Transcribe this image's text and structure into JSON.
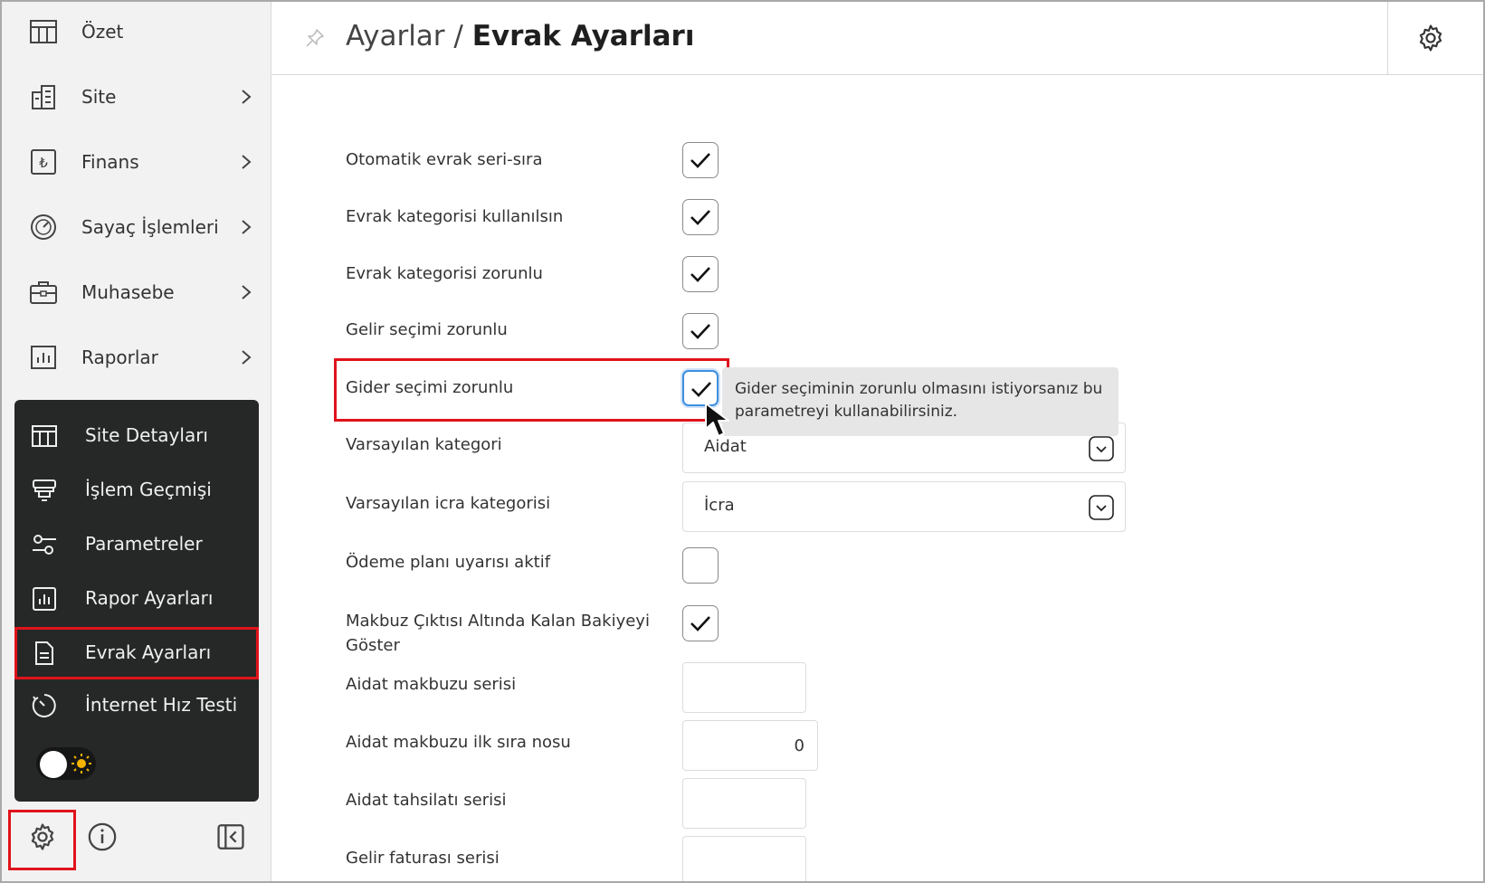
{
  "sidebar": {
    "items": [
      {
        "label": "Özet",
        "icon": "table-icon",
        "has_chevron": false
      },
      {
        "label": "Site",
        "icon": "building-icon",
        "has_chevron": true
      },
      {
        "label": "Finans",
        "icon": "lira-icon",
        "has_chevron": true
      },
      {
        "label": "Sayaç İşlemleri",
        "icon": "gauge-icon",
        "has_chevron": true
      },
      {
        "label": "Muhasebe",
        "icon": "briefcase-icon",
        "has_chevron": true
      },
      {
        "label": "Raporlar",
        "icon": "bar-chart-icon",
        "has_chevron": true
      }
    ],
    "submenu": [
      {
        "label": "Site Detayları",
        "icon": "table-icon"
      },
      {
        "label": "İşlem Geçmişi",
        "icon": "stack-icon"
      },
      {
        "label": "Parametreler",
        "icon": "sliders-icon"
      },
      {
        "label": "Rapor Ayarları",
        "icon": "bar-chart-icon"
      },
      {
        "label": "Evrak Ayarları",
        "icon": "document-icon",
        "active": true
      },
      {
        "label": "İnternet Hız Testi",
        "icon": "speed-icon"
      }
    ],
    "theme_toggle": {
      "state": "light",
      "icon": "sun-icon"
    },
    "bottom": {
      "settings_icon": "gear-icon",
      "info_icon": "info-icon",
      "collapse_icon": "collapse-sidebar-icon"
    }
  },
  "header": {
    "breadcrumb_parent": "Ayarlar",
    "separator": " / ",
    "breadcrumb_current": "Evrak Ayarları",
    "pin_icon": "pin-icon",
    "settings_icon": "gear-icon"
  },
  "form": {
    "rows": [
      {
        "label": "Otomatik evrak seri-sıra",
        "type": "checkbox",
        "checked": true
      },
      {
        "label": "Evrak kategorisi kullanılsın",
        "type": "checkbox",
        "checked": true
      },
      {
        "label": "Evrak kategorisi zorunlu",
        "type": "checkbox",
        "checked": true
      },
      {
        "label": "Gelir seçimi zorunlu",
        "type": "checkbox",
        "checked": true
      },
      {
        "label": "Gider seçimi zorunlu",
        "type": "checkbox",
        "checked": true,
        "focused": true
      },
      {
        "label": "Varsayılan kategori",
        "type": "select",
        "value": "Aidat"
      },
      {
        "label": "Varsayılan icra kategorisi",
        "type": "select",
        "value": "İcra"
      },
      {
        "label": "Ödeme planı uyarısı aktif",
        "type": "checkbox",
        "checked": false
      },
      {
        "label_line1": "Makbuz Çıktısı Altında Kalan Bakiyeyi",
        "label_line2": "Göster",
        "type": "checkbox",
        "checked": true
      },
      {
        "label": "Aidat makbuzu serisi",
        "type": "text",
        "value": ""
      },
      {
        "label": "Aidat makbuzu ilk sıra nosu",
        "type": "number",
        "value": "0"
      },
      {
        "label": "Aidat tahsilatı serisi",
        "type": "text",
        "value": ""
      },
      {
        "label": "Gelir faturası serisi",
        "type": "text",
        "value": ""
      }
    ]
  },
  "tooltip": {
    "text": "Gider seçiminin zorunlu olmasını istiyorsanız bu parametreyi kullanabilirsiniz."
  },
  "colors": {
    "highlight": "#e0131b",
    "sidebar_bg": "#f2f2f2",
    "submenu_bg": "#262828",
    "focus": "#3d8fe0",
    "tooltip_bg": "#e6e6e6"
  }
}
